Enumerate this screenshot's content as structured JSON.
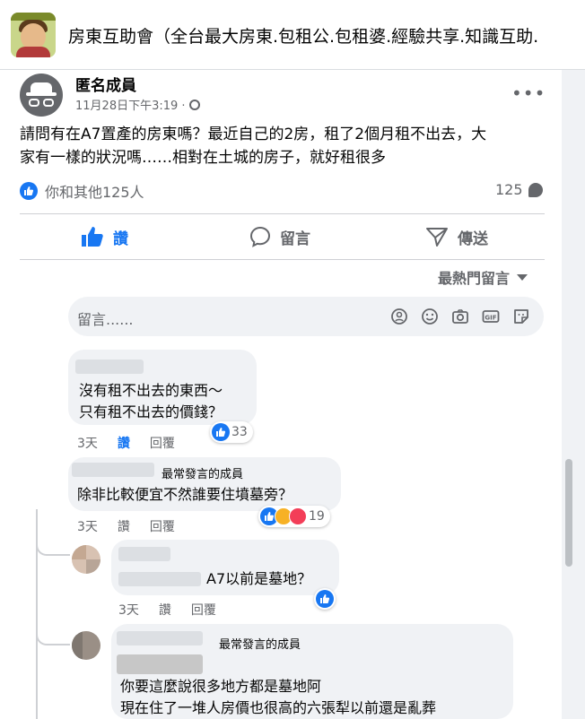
{
  "group": {
    "title": "房東互助會（全台最大房東.包租公.包租婆.經驗共享.知識互助."
  },
  "post": {
    "author": "匿名成員",
    "timestamp": "11月28日下午3:19",
    "text_line1": "請問有在A7置產的房東嗎？最近自己的2房，租了2個月租不出去，大",
    "text_line2": "家有一樣的狀況嗎……相對在土城的房子，就好租很多",
    "reactions_text": "你和其他125人",
    "comment_count": "125"
  },
  "actions": {
    "like": "讚",
    "comment": "留言",
    "share": "傳送"
  },
  "sort_label": "最熱門留言",
  "composer": {
    "placeholder": "留言......"
  },
  "comments": [
    {
      "line1": "沒有租不出去的東西～",
      "line2": "只有租不出去的價錢？",
      "age": "3天",
      "like": "讚",
      "reply": "回覆",
      "reactions": "33"
    },
    {
      "badge": "最常發言的成員",
      "text": "除非比較便宜不然誰要住墳墓旁？",
      "age": "3天",
      "like": "讚",
      "reply": "回覆",
      "reactions": "19"
    },
    {
      "text": "A7以前是墓地？",
      "age": "3天",
      "like": "讚",
      "reply": "回覆"
    },
    {
      "badge": "最常發言的成員",
      "line1": "你要這麼說很多地方都是墓地阿",
      "line2": "現在住了一堆人房價也很高的六張犁以前還是亂葬"
    }
  ],
  "colors": {
    "accent": "#1877f2",
    "muted": "#65676b",
    "bubble": "#f0f2f5",
    "background": "#f0f2f5"
  }
}
